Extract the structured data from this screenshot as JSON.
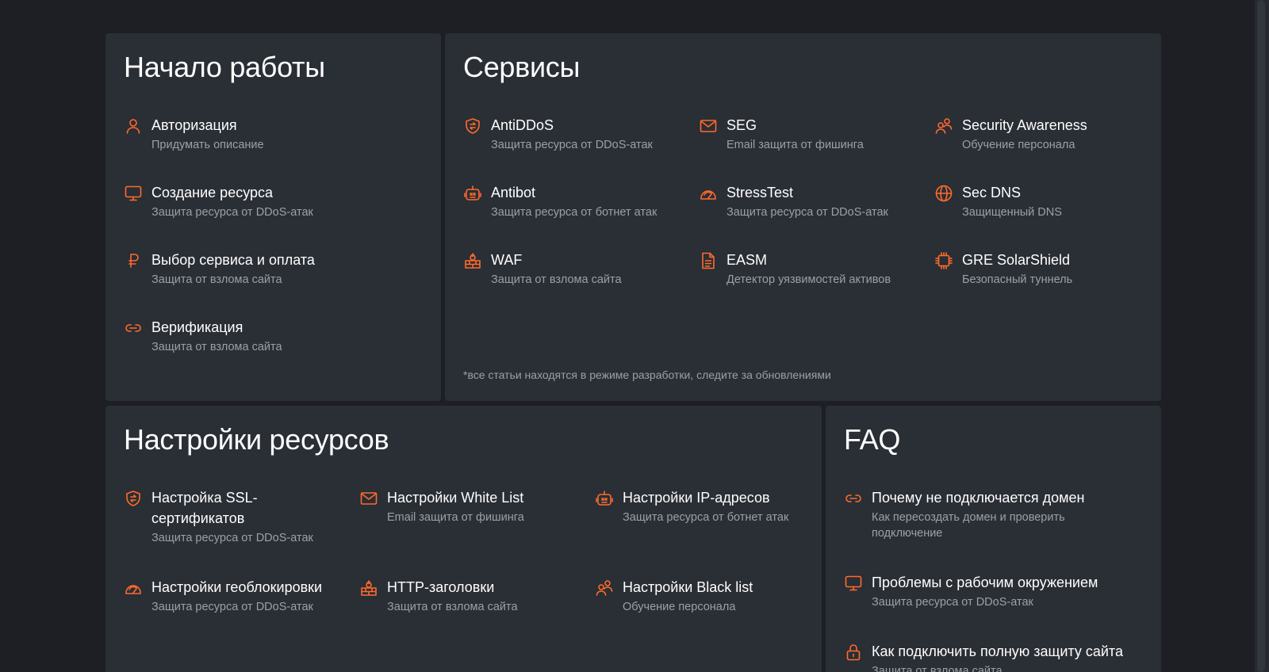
{
  "accent_color": "#ff6b2c",
  "start": {
    "title": "Начало работы",
    "items": [
      {
        "title": "Авторизация",
        "subtitle": "Придумать описание",
        "icon": "user-icon"
      },
      {
        "title": "Создание ресурса",
        "subtitle": "Защита ресурса от DDoS-атак",
        "icon": "monitor-icon"
      },
      {
        "title": "Выбор сервиса и оплата",
        "subtitle": "Защита от взлома сайта",
        "icon": "ruble-icon"
      },
      {
        "title": "Верификация",
        "subtitle": "Защита от взлома сайта",
        "icon": "link-icon"
      }
    ]
  },
  "services": {
    "title": "Сервисы",
    "items": [
      {
        "title": "AntiDDoS",
        "subtitle": "Защита ресурса от DDoS-атак",
        "icon": "shield-arrows-icon"
      },
      {
        "title": "SEG",
        "subtitle": "Email защита от фишинга",
        "icon": "mail-icon"
      },
      {
        "title": "Security Awareness",
        "subtitle": "Обучение персонала",
        "icon": "users-icon"
      },
      {
        "title": "Antibot",
        "subtitle": "Защита ресурса от ботнет атак",
        "icon": "robot-icon"
      },
      {
        "title": "StressTest",
        "subtitle": "Защита ресурса от DDoS-атак",
        "icon": "gauge-icon"
      },
      {
        "title": "Sec DNS",
        "subtitle": "Защищенный DNS",
        "icon": "globe-icon"
      },
      {
        "title": "WAF",
        "subtitle": "Защита от взлома сайта",
        "icon": "firewall-icon"
      },
      {
        "title": "EASM",
        "subtitle": "Детектор уязвимостей активов",
        "icon": "document-icon"
      },
      {
        "title": "GRE SolarShield",
        "subtitle": "Безопасный туннель",
        "icon": "chip-icon"
      }
    ],
    "note": "*все статьи находятся в режиме разработки, следите за обновлениями"
  },
  "resources": {
    "title": "Настройки ресурсов",
    "items": [
      {
        "title": "Настройка SSL-сертификатов",
        "subtitle": "Защита ресурса от DDoS-атак",
        "icon": "shield-arrows-icon"
      },
      {
        "title": "Настройки White List",
        "subtitle": "Email защита от фишинга",
        "icon": "mail-icon"
      },
      {
        "title": "Настройки IP-адресов",
        "subtitle": "Защита ресурса от ботнет атак",
        "icon": "robot-icon"
      },
      {
        "title": "Настройки геоблокировки",
        "subtitle": "Защита ресурса от DDoS-атак",
        "icon": "gauge-icon"
      },
      {
        "title": "HTTP-заголовки",
        "subtitle": "Защита от взлома сайта",
        "icon": "firewall-icon"
      },
      {
        "title": "Настройки Black list",
        "subtitle": "Обучение персонала",
        "icon": "users-icon"
      }
    ]
  },
  "faq": {
    "title": "FAQ",
    "items": [
      {
        "title": "Почему не подключается домен",
        "subtitle": "Как пересоздать домен и проверить подключение",
        "icon": "link-icon"
      },
      {
        "title": "Проблемы с рабочим окружением",
        "subtitle": "Защита ресурса от DDoS-атак",
        "icon": "monitor-icon"
      },
      {
        "title": "Как подключить полную защиту сайта",
        "subtitle": "Защита от взлома сайта",
        "icon": "lock-icon"
      }
    ]
  }
}
